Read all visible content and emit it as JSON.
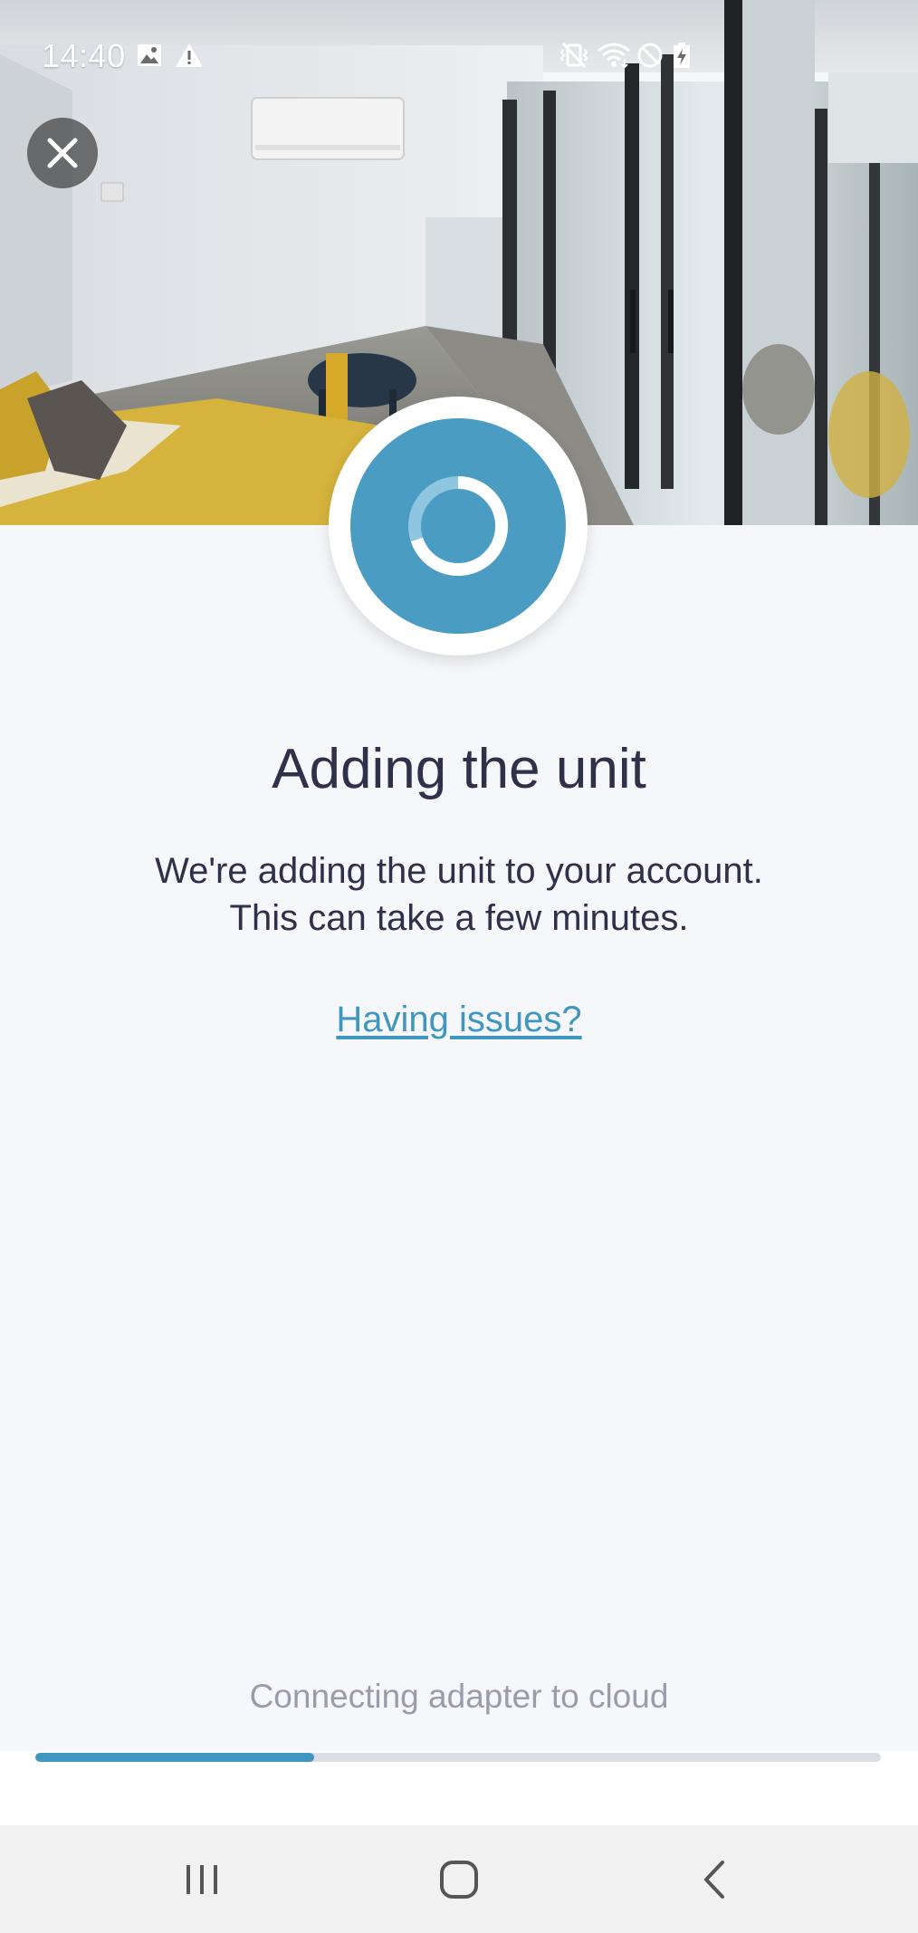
{
  "status_bar": {
    "time": "14:40",
    "left_icons": [
      "image-icon",
      "warning-icon"
    ],
    "right_icons": [
      "vibrate-mute-icon",
      "wifi-icon",
      "do-not-disturb-icon",
      "battery-charging-icon"
    ]
  },
  "close_button": {
    "icon": "close-icon"
  },
  "loader": {
    "icon": "loading-spinner-icon",
    "accent_color": "#4a9cc3"
  },
  "content": {
    "title": "Adding the unit",
    "message_line1": "We're adding the unit to your account.",
    "message_line2": "This can take a few minutes.",
    "help_link": "Having issues?"
  },
  "progress": {
    "label": "Connecting adapter to cloud",
    "fraction": 0.33,
    "color": "#3f96bf"
  },
  "nav_bar": {
    "buttons": [
      "recent-apps-icon",
      "home-icon",
      "back-icon"
    ]
  }
}
